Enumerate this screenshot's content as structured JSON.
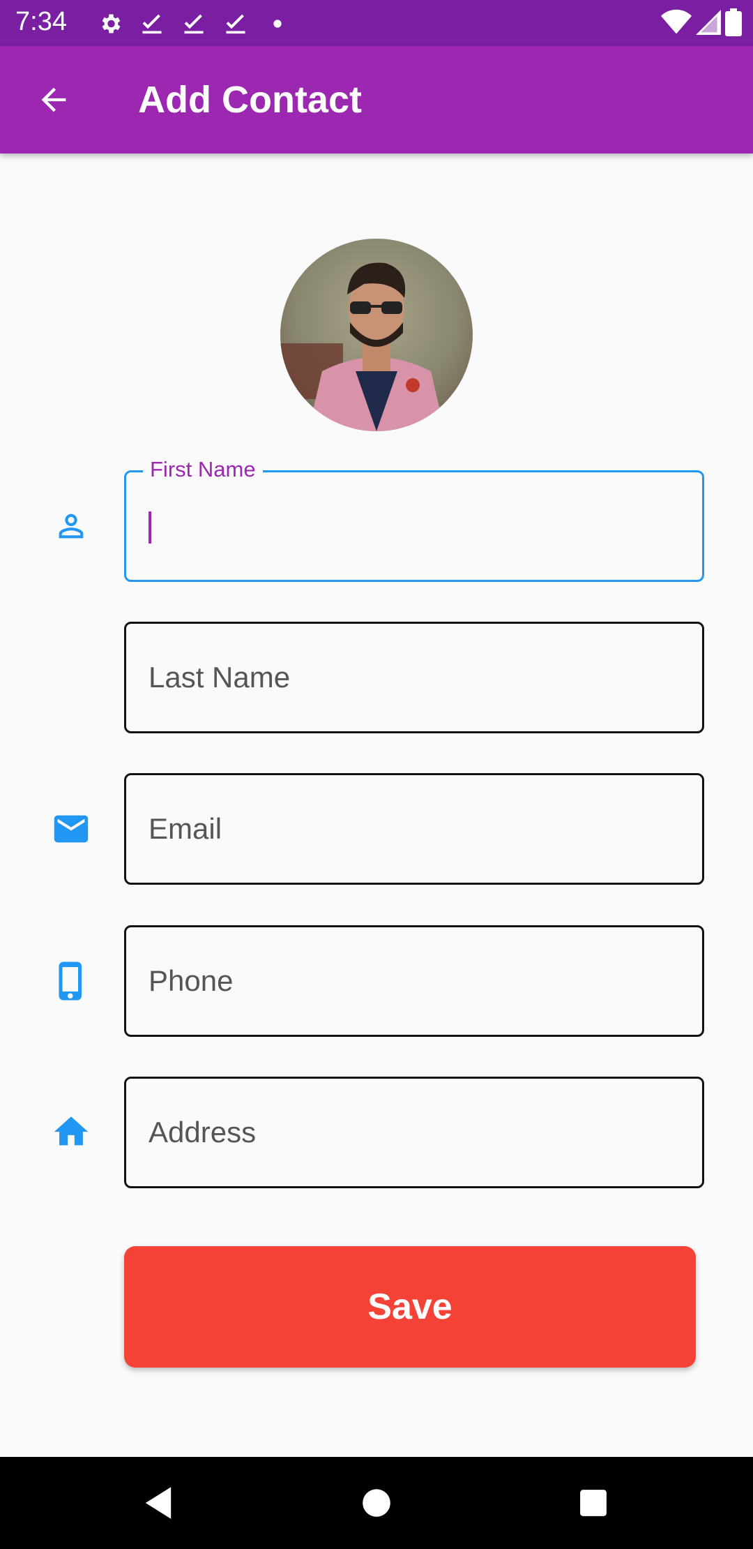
{
  "status_bar": {
    "time": "7:34",
    "icons_left": [
      "gear-icon",
      "check-icon",
      "check-icon",
      "check-icon",
      "dot-icon"
    ],
    "icons_right": [
      "wifi-icon",
      "signal-icon",
      "battery-icon"
    ]
  },
  "app_bar": {
    "title": "Add Contact",
    "back_icon": "arrow-back-icon",
    "color": "#9c27b0"
  },
  "avatar": {
    "icon": "profile-photo"
  },
  "form": {
    "first_name": {
      "label": "First Name",
      "value": "",
      "icon": "person-icon"
    },
    "last_name": {
      "placeholder": "Last Name"
    },
    "email": {
      "placeholder": "Email",
      "icon": "mail-icon"
    },
    "phone": {
      "placeholder": "Phone",
      "icon": "phone-icon"
    },
    "address": {
      "placeholder": "Address",
      "icon": "home-icon"
    }
  },
  "save_button": {
    "label": "Save",
    "color": "#f44336"
  },
  "colors": {
    "accent": "#9c27b0",
    "focus_border": "#2196f3",
    "icon_blue": "#2196f3"
  },
  "nav_bar": {
    "icons": [
      "back-triangle-icon",
      "home-circle-icon",
      "recents-square-icon"
    ]
  }
}
